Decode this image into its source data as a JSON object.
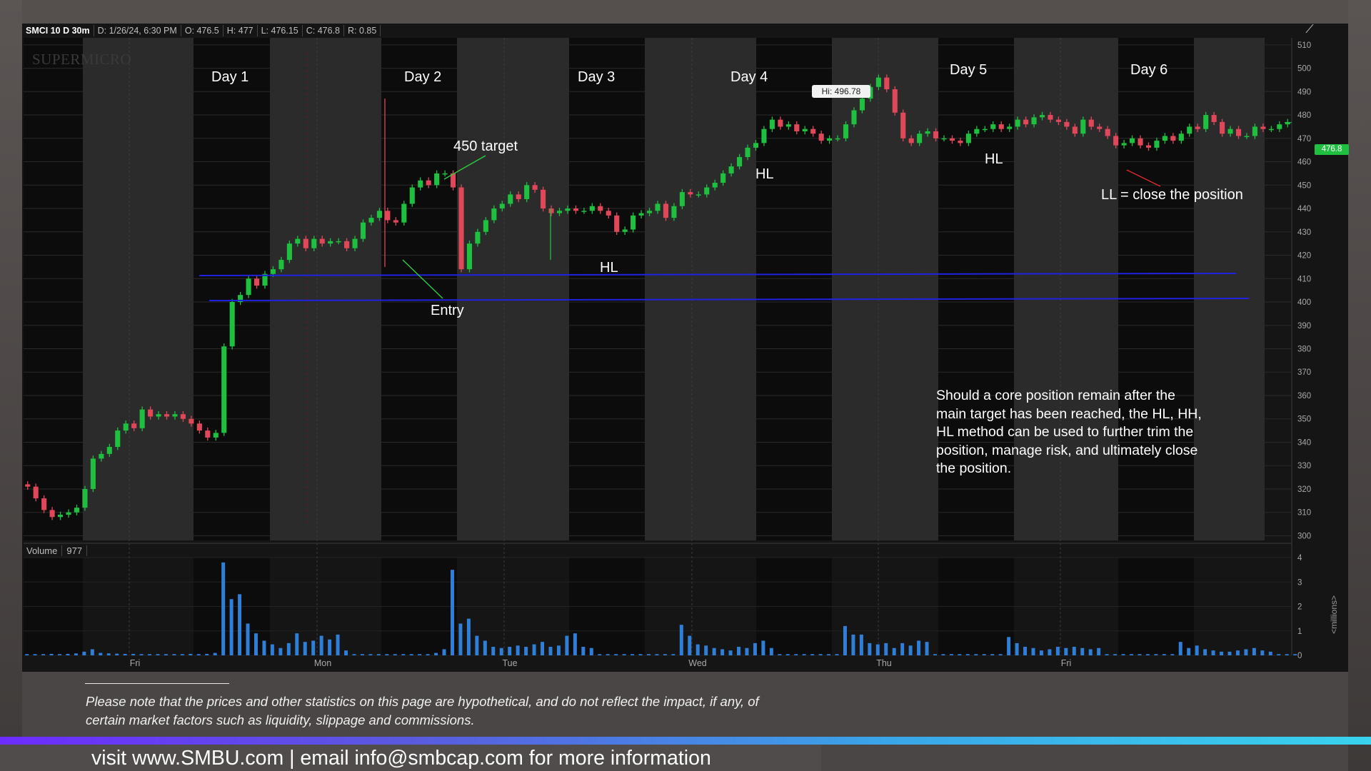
{
  "window": {
    "symbol": "SMCI 10 D 30m",
    "date": "D: 1/26/24, 6:30 PM",
    "open": "O: 476.5",
    "high": "H: 477",
    "low": "L: 476.15",
    "close": "C: 476.8",
    "range": "R: 0.85",
    "watermark": "SUPERMICRO",
    "volume_label": "Volume",
    "volume_value": "977",
    "volume_unit": "<millions>",
    "hi_callout": "Hi: 496.78",
    "last_price": "476.8"
  },
  "annotations": {
    "day1": "Day 1",
    "day2": "Day 2",
    "day3": "Day 3",
    "day4": "Day 4",
    "day5": "Day 5",
    "day6": "Day 6",
    "target": "450 target",
    "entry": "Entry",
    "hl1": "HL",
    "hl2": "HL",
    "hl3": "HL",
    "ll": "LL = close the position",
    "note": "Should a core position remain after the main target has been reached, the HL, HH, HL method can be used to further trim the position, manage risk, and ultimately close the position."
  },
  "disclaimer": "Please note that the prices and other statistics on this page are hypothetical, and do not reflect the impact, if any, of certain market factors such as liquidity, slippage and commissions.",
  "footer": "visit www.SMBU.com | email info@smbcap.com for more information",
  "colors": {
    "up": "#1fbf3f",
    "down": "#e0485a",
    "volume": "#2f7fd8",
    "level_line": "#1f22e0",
    "chart_bg": "#151515",
    "shade": "#2b2b2b"
  },
  "chart_data": {
    "type": "candlestick",
    "title": "SMCI 10 D 30m",
    "x_labels": [
      "Fri",
      "Mon",
      "Tue",
      "Wed",
      "Thu",
      "Fri"
    ],
    "price_ticks": [
      510,
      500,
      490,
      480,
      470,
      460,
      450,
      440,
      430,
      420,
      410,
      400,
      390,
      380,
      370,
      360,
      350,
      340,
      330,
      320,
      310,
      300
    ],
    "price_range": [
      298,
      513
    ],
    "volume_ticks": [
      4,
      3,
      2,
      1,
      0
    ],
    "volume_range": [
      0,
      4
    ],
    "support_levels": [
      411,
      400
    ],
    "high": 496.78,
    "last": 476.8,
    "close_series": [
      321,
      316,
      311,
      308,
      309,
      310,
      312,
      320,
      333,
      335,
      338,
      345,
      348,
      346,
      354,
      351,
      352,
      351,
      352,
      350,
      348,
      345,
      342,
      344,
      381,
      400,
      403,
      410,
      407,
      412,
      414,
      418,
      425,
      427,
      423,
      427,
      425,
      426,
      426,
      423,
      427,
      434,
      436,
      439,
      435,
      434,
      442,
      449,
      452,
      450,
      455,
      455,
      449,
      414,
      425,
      430,
      435,
      440,
      442,
      446,
      444,
      450,
      448,
      440,
      438,
      439,
      440,
      439,
      439,
      441,
      439,
      437,
      430,
      431,
      437,
      438,
      439,
      442,
      436,
      441,
      447,
      446,
      446,
      449,
      451,
      455,
      458,
      462,
      466,
      468,
      474,
      478,
      475,
      476,
      473,
      474,
      472,
      469,
      470,
      470,
      476,
      482,
      487,
      492,
      496,
      491,
      481,
      470,
      468,
      472,
      473,
      470,
      470,
      469,
      468,
      472,
      474,
      474,
      476,
      474,
      475,
      478,
      476,
      479,
      480,
      478,
      477,
      475,
      472,
      478,
      475,
      474,
      471,
      467,
      468,
      470,
      467,
      466,
      469,
      471,
      469,
      472,
      475,
      474,
      480,
      477,
      472,
      474,
      471,
      471,
      475,
      474,
      474,
      476,
      477
    ],
    "volume_series": [
      0.05,
      0.05,
      0.05,
      0.06,
      0.05,
      0.06,
      0.08,
      0.15,
      0.25,
      0.1,
      0.08,
      0.07,
      0.06,
      0.06,
      0.05,
      0.05,
      0.05,
      0.05,
      0.05,
      0.05,
      0.06,
      0.05,
      0.06,
      0.1,
      3.8,
      2.3,
      2.5,
      1.3,
      0.9,
      0.6,
      0.45,
      0.3,
      0.5,
      0.9,
      0.55,
      0.6,
      0.8,
      0.65,
      0.85,
      0.2,
      0.05,
      0.05,
      0.05,
      0.05,
      0.05,
      0.05,
      0.05,
      0.05,
      0.05,
      0.05,
      0.1,
      0.25,
      3.5,
      1.3,
      1.5,
      0.8,
      0.6,
      0.35,
      0.3,
      0.35,
      0.4,
      0.35,
      0.45,
      0.55,
      0.35,
      0.4,
      0.8,
      0.9,
      0.35,
      0.3,
      0.05,
      0.05,
      0.05,
      0.05,
      0.05,
      0.05,
      0.05,
      0.05,
      0.05,
      0.05,
      1.25,
      0.8,
      0.45,
      0.4,
      0.3,
      0.25,
      0.2,
      0.35,
      0.3,
      0.5,
      0.6,
      0.3,
      0.05,
      0.05,
      0.05,
      0.05,
      0.05,
      0.05,
      0.05,
      0.05,
      1.2,
      0.85,
      0.85,
      0.5,
      0.45,
      0.5,
      0.3,
      0.5,
      0.4,
      0.6,
      0.55,
      0.05,
      0.05,
      0.05,
      0.05,
      0.05,
      0.05,
      0.05,
      0.05,
      0.05,
      0.75,
      0.5,
      0.35,
      0.3,
      0.2,
      0.25,
      0.35,
      0.3,
      0.35,
      0.3,
      0.25,
      0.3,
      0.05,
      0.05,
      0.05,
      0.05,
      0.05,
      0.05,
      0.05,
      0.05,
      0.05,
      0.55,
      0.3,
      0.4,
      0.25,
      0.2,
      0.15,
      0.15,
      0.2,
      0.25,
      0.3,
      0.2,
      0.15,
      0.05,
      0.05,
      0.05
    ]
  }
}
